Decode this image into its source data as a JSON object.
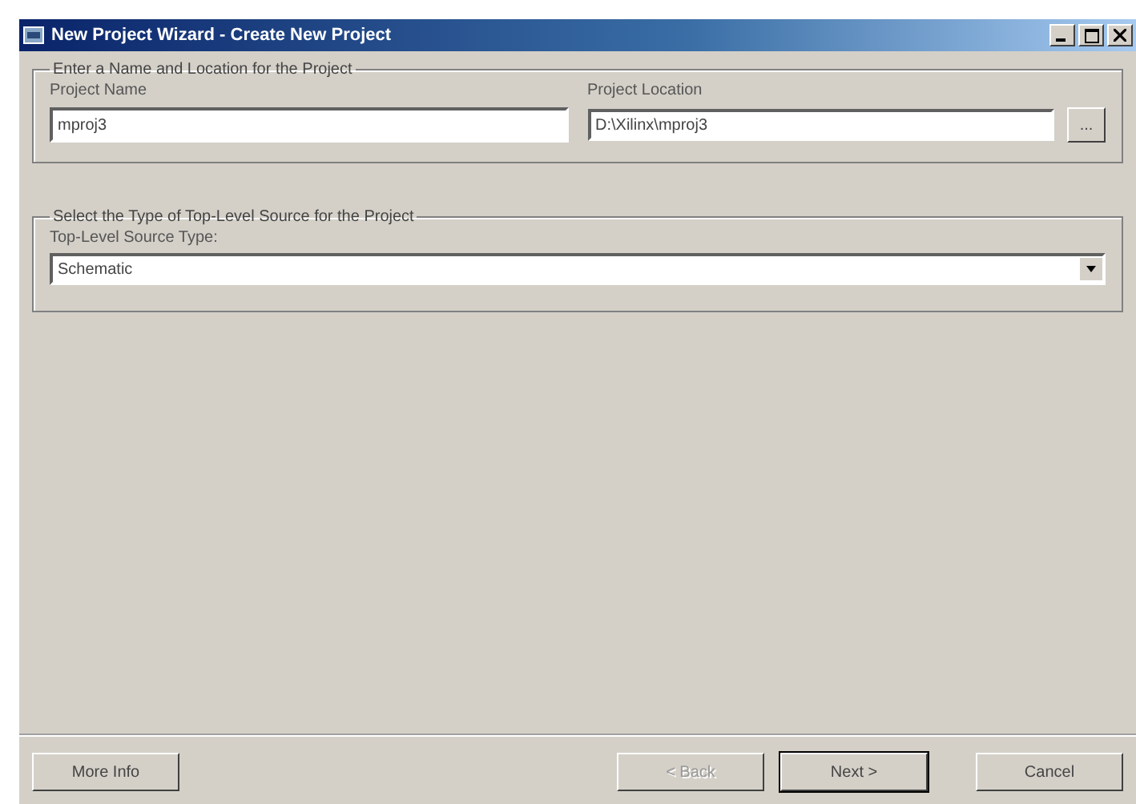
{
  "window": {
    "title": "New Project Wizard - Create New Project"
  },
  "name_group": {
    "legend": "Enter a Name and Location for the Project",
    "name_label": "Project Name",
    "name_value": "mproj3",
    "location_label": "Project Location",
    "location_value": "D:\\Xilinx\\mproj3",
    "browse": "..."
  },
  "source_group": {
    "legend": "Select the Type of Top-Level Source for the Project",
    "label": "Top-Level Source Type:",
    "value": "Schematic"
  },
  "buttons": [
    {
      "label": "More Info",
      "disabled": false,
      "default": false
    },
    {
      "label": "< Back",
      "disabled": true,
      "default": false
    },
    {
      "label": "Next >",
      "disabled": false,
      "default": true
    },
    {
      "label": "Cancel",
      "disabled": false,
      "default": false
    }
  ]
}
